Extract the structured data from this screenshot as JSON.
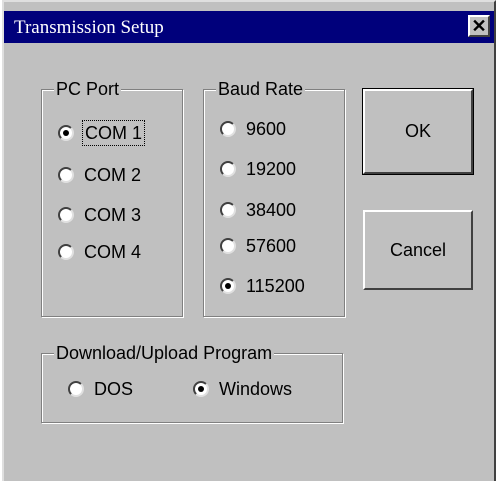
{
  "window": {
    "title": "Transmission Setup",
    "close_glyph": "✕"
  },
  "pc_port": {
    "label": "PC Port",
    "options": [
      "COM 1",
      "COM 2",
      "COM 3",
      "COM 4"
    ],
    "selected": "COM 1"
  },
  "baud_rate": {
    "label": "Baud Rate",
    "options": [
      "9600",
      "19200",
      "38400",
      "57600",
      "115200"
    ],
    "selected": "115200"
  },
  "program": {
    "label": "Download/Upload Program",
    "options": [
      "DOS",
      "Windows"
    ],
    "selected": "Windows"
  },
  "buttons": {
    "ok": "OK",
    "cancel": "Cancel"
  },
  "colors": {
    "titlebar": "#00007b",
    "face": "#c0c0c0"
  }
}
